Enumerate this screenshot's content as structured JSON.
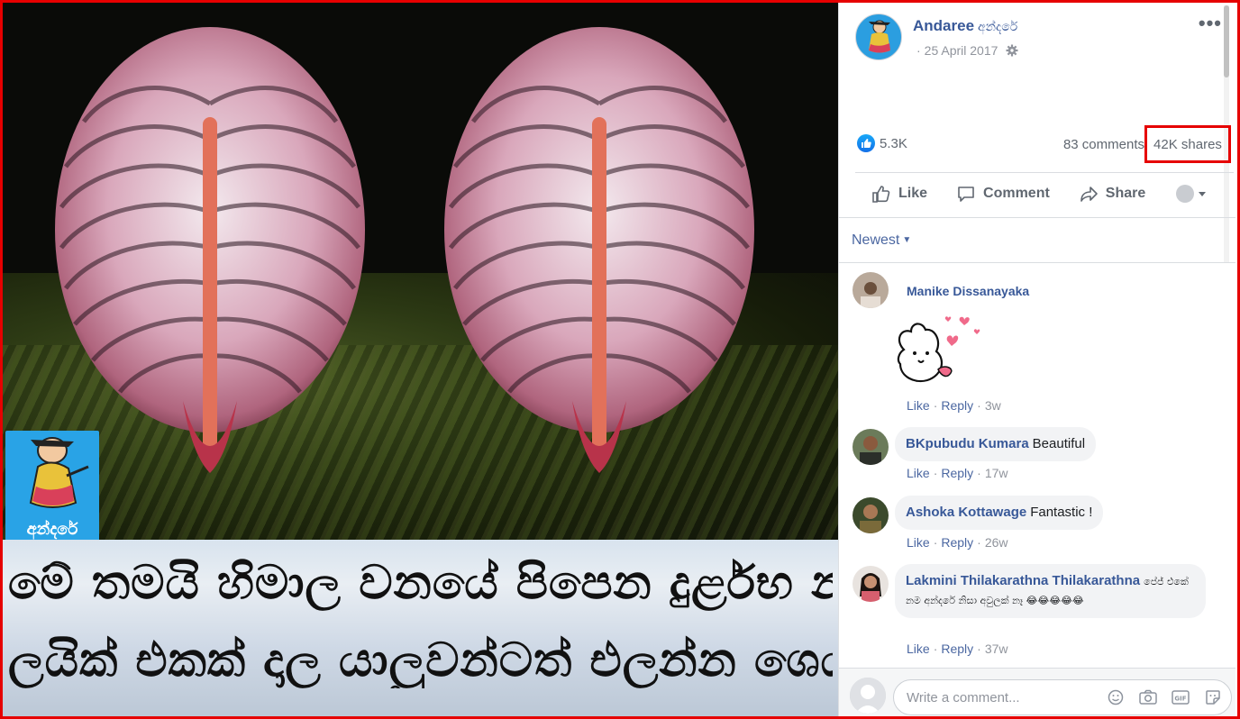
{
  "post": {
    "page_name": "Andaree",
    "page_name_si": "අන්දරේ",
    "date": "25 April 2017",
    "more": "•••",
    "likes": "5.3K",
    "comments": "83 comments",
    "shares": "42K shares"
  },
  "image": {
    "logo_text": "අන්දරේ",
    "caption_line_1": "මේ තමයි හිමාල වනයේ පිපෙන දුර්ළභ නාග රාජ මල",
    "caption_line_2": "ලයික් එකක් දාල යාලුවන්ටත් එලන්න ශෙයා කරන්න"
  },
  "actions": {
    "like": "Like",
    "comment": "Comment",
    "share": "Share"
  },
  "sort": {
    "label": "Newest"
  },
  "comment_meta": {
    "like": "Like",
    "reply": "Reply"
  },
  "comments": [
    {
      "name": "Manike Dissanayaka",
      "text": "",
      "time": "3w"
    },
    {
      "name": "BKpubudu Kumara",
      "text": "Beautiful",
      "time": "17w"
    },
    {
      "name": "Ashoka Kottawage",
      "text": "Fantastic !",
      "time": "26w"
    },
    {
      "name": "Lakmini Thilakarathna Thilakarathna",
      "text": "පේජ් එකේ නම අන්දරේ නිසා අවුලක් නෑ 😂😂😂😂😂",
      "time": "37w"
    }
  ],
  "composer": {
    "placeholder": "Write a comment..."
  },
  "colors": {
    "link": "#385898",
    "highlight": "#e60000",
    "like_blue": "#1877f2"
  }
}
